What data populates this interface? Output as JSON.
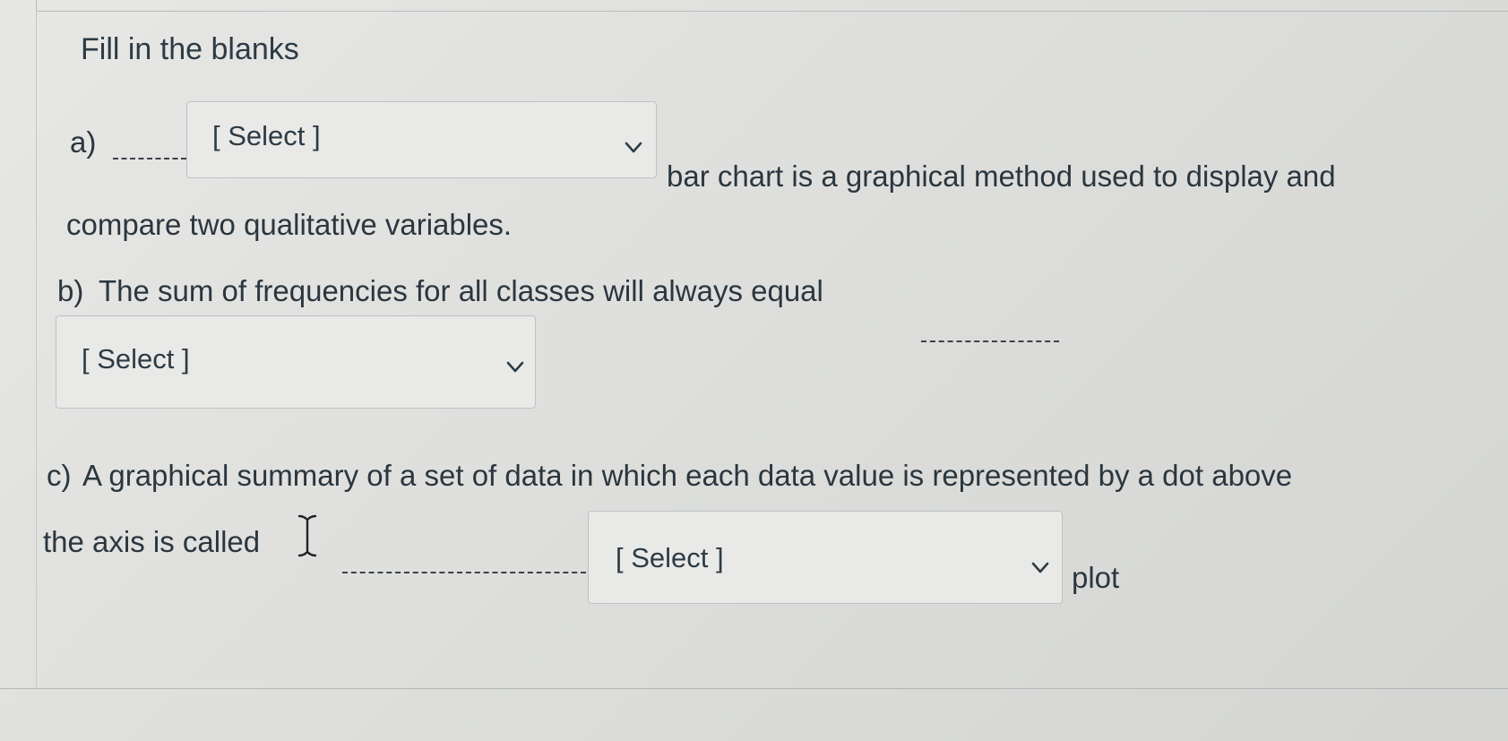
{
  "quiz": {
    "title": "Fill in the blanks",
    "questions": [
      {
        "label": "a)",
        "text_after": "bar chart is a graphical method used to display and",
        "text_continued": "compare two qualitative variables.",
        "select": {
          "value": "[ Select ]"
        }
      },
      {
        "label": "b)",
        "text_before": "The sum of frequencies for all classes will always equal",
        "select": {
          "value": "[ Select ]"
        }
      },
      {
        "label": "c)",
        "text_line1": "A graphical summary of a set of data in which each data value is represented by a dot above",
        "text_line2": "the axis is called",
        "text_after": "plot",
        "select": {
          "value": "[ Select ]"
        }
      }
    ]
  },
  "icons": {
    "dropdown": "chevron-down-icon",
    "cursor": "text-cursor-icon"
  }
}
